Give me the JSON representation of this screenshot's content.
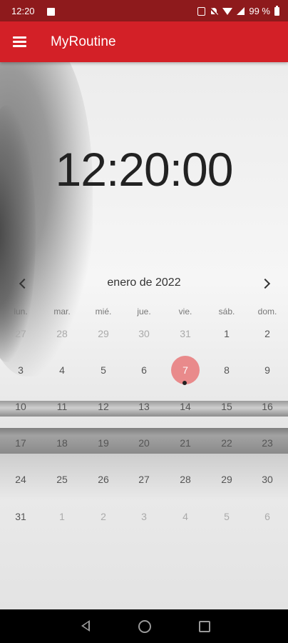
{
  "status_bar": {
    "time": "12:20",
    "battery": "99 %",
    "icons": [
      "image-icon",
      "nfc-icon",
      "mute-icon",
      "wifi-icon",
      "signal-icon",
      "battery-icon"
    ]
  },
  "app_bar": {
    "title": "MyRoutine",
    "menu_icon": "menu-icon",
    "color": "#d32027",
    "status_color": "#8e1a1c"
  },
  "clock": {
    "time": "12:20:00"
  },
  "calendar": {
    "month": "enero de 2022",
    "weekdays": [
      "lun.",
      "mar.",
      "mié.",
      "jue.",
      "vie.",
      "sáb.",
      "dom."
    ],
    "weeks": [
      [
        {
          "d": "27",
          "muted": true
        },
        {
          "d": "28",
          "muted": true
        },
        {
          "d": "29",
          "muted": true
        },
        {
          "d": "30",
          "muted": true
        },
        {
          "d": "31",
          "muted": true
        },
        {
          "d": "1",
          "muted": false
        },
        {
          "d": "2",
          "muted": false
        }
      ],
      [
        {
          "d": "3",
          "muted": false
        },
        {
          "d": "4",
          "muted": false
        },
        {
          "d": "5",
          "muted": false
        },
        {
          "d": "6",
          "muted": false
        },
        {
          "d": "7",
          "muted": false,
          "selected": true,
          "event": true
        },
        {
          "d": "8",
          "muted": false
        },
        {
          "d": "9",
          "muted": false
        }
      ],
      [
        {
          "d": "10",
          "muted": false
        },
        {
          "d": "11",
          "muted": false
        },
        {
          "d": "12",
          "muted": false
        },
        {
          "d": "13",
          "muted": false
        },
        {
          "d": "14",
          "muted": false
        },
        {
          "d": "15",
          "muted": false
        },
        {
          "d": "16",
          "muted": false
        }
      ],
      [
        {
          "d": "17",
          "muted": false
        },
        {
          "d": "18",
          "muted": false
        },
        {
          "d": "19",
          "muted": false
        },
        {
          "d": "20",
          "muted": false
        },
        {
          "d": "21",
          "muted": false
        },
        {
          "d": "22",
          "muted": false
        },
        {
          "d": "23",
          "muted": false
        }
      ],
      [
        {
          "d": "24",
          "muted": false
        },
        {
          "d": "25",
          "muted": false
        },
        {
          "d": "26",
          "muted": false
        },
        {
          "d": "27",
          "muted": false
        },
        {
          "d": "28",
          "muted": false
        },
        {
          "d": "29",
          "muted": false
        },
        {
          "d": "30",
          "muted": false
        }
      ],
      [
        {
          "d": "31",
          "muted": false
        },
        {
          "d": "1",
          "muted": true
        },
        {
          "d": "2",
          "muted": true
        },
        {
          "d": "3",
          "muted": true
        },
        {
          "d": "4",
          "muted": true
        },
        {
          "d": "5",
          "muted": true
        },
        {
          "d": "6",
          "muted": true
        }
      ]
    ],
    "selected_color": "#e98a8b"
  },
  "nav_bar": {
    "icons": [
      "back-icon",
      "home-icon",
      "recents-icon"
    ]
  }
}
